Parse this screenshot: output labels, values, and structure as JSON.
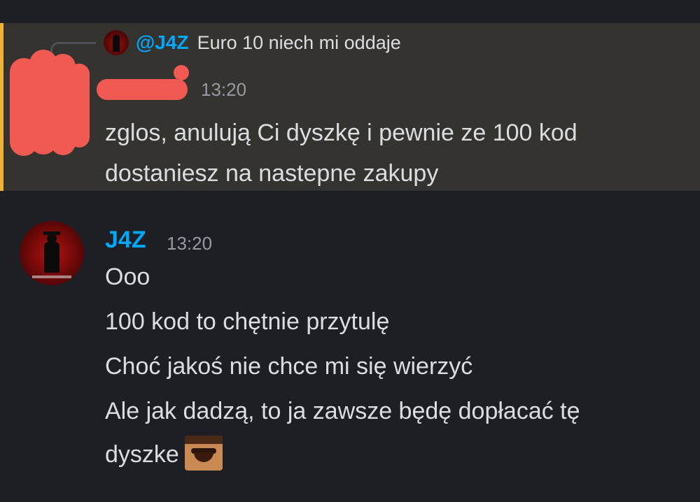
{
  "reply": {
    "author": "@J4Z",
    "text": "Euro 10 niech mi oddaje"
  },
  "message1": {
    "time": "13:20",
    "text": "zglos, anulują Ci dyszkę i pewnie ze 100 kod dostaniesz na nastepne zakupy"
  },
  "message2": {
    "author": "J4Z",
    "time": "13:20",
    "lines": [
      "Ooo",
      "100 kod to chętnie przytulę",
      "Choć jakoś nie chce mi się wierzyć",
      "Ale jak dadzą, to ja zawsze będę dopłacać tę",
      "dyszke"
    ],
    "emoji": "laughing-mustache-man-emoji"
  },
  "colors": {
    "background": "#1e1f24",
    "mention_background": "#353330",
    "mention_bar": "#f0b232",
    "username": "#00a8fc",
    "text": "#dbdee1",
    "timestamp": "#949ba4",
    "redaction": "#f05a52"
  }
}
